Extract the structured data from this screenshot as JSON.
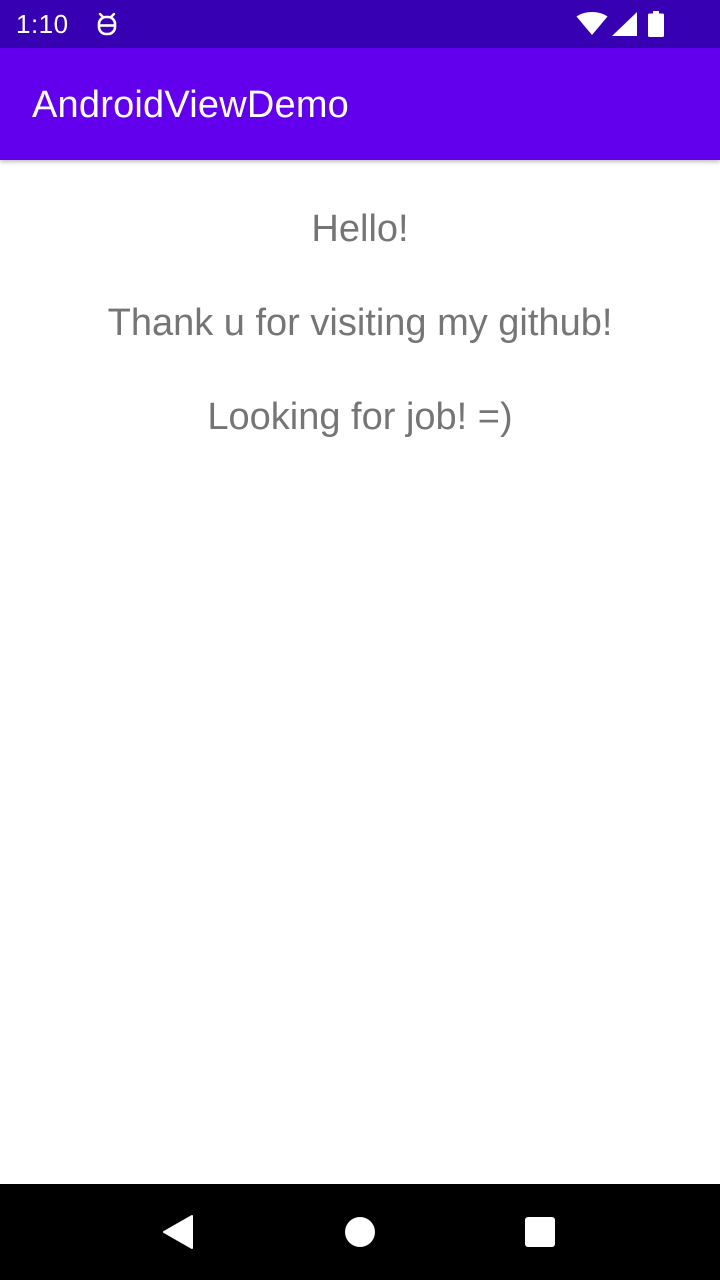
{
  "status_bar": {
    "time": "1:10",
    "icons": [
      "debug-icon",
      "wifi-icon",
      "signal-icon",
      "battery-icon"
    ],
    "background": "#3700b3"
  },
  "app_bar": {
    "title": "AndroidViewDemo",
    "background": "#6200ee"
  },
  "content": {
    "lines": [
      "Hello!",
      "Thank u for visiting my github!",
      "Looking for job! =)"
    ],
    "text_color": "#757575"
  },
  "nav_bar": {
    "icons": [
      "back-icon",
      "home-icon",
      "recents-icon"
    ],
    "background": "#000000"
  }
}
